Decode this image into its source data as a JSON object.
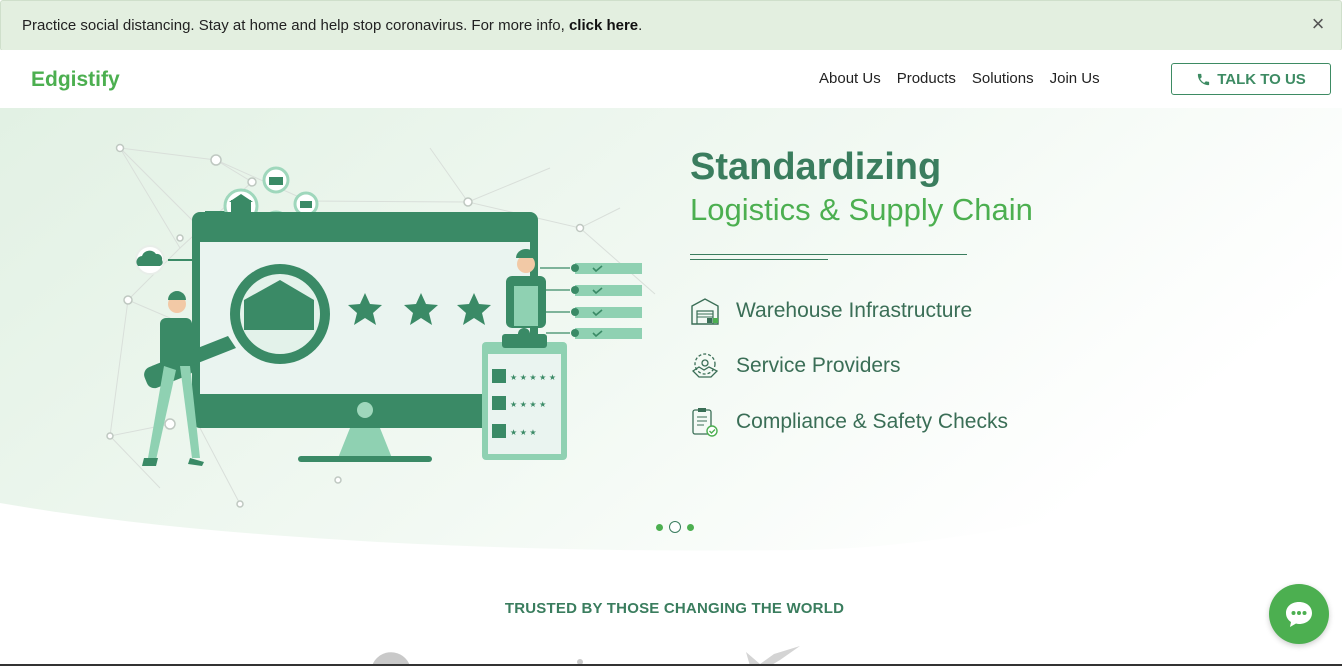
{
  "alert": {
    "text": "Practice social distancing. Stay at home and help stop coronavirus. For more info, ",
    "link": "click here",
    "suffix": ".",
    "close": "×"
  },
  "header": {
    "logo": "Edgistify",
    "nav": [
      "About Us",
      "Products",
      "Solutions",
      "Join Us"
    ],
    "cta": "TALK TO US"
  },
  "hero": {
    "title": "Standardizing",
    "subtitle": "Logistics & Supply Chain",
    "features": [
      {
        "label": "Warehouse Infrastructure",
        "icon": "warehouse-icon"
      },
      {
        "label": "Service Providers",
        "icon": "handshake-gear-icon"
      },
      {
        "label": "Compliance & Safety Checks",
        "icon": "clipboard-check-icon"
      }
    ],
    "slides": 3,
    "active_slide": 2
  },
  "trusted": {
    "heading": "TRUSTED BY THOSE CHANGING THE WORLD"
  },
  "colors": {
    "brand_green": "#4caf50",
    "dark_green": "#3a7d5e",
    "alert_bg": "#e3efe0",
    "hero_bg": "#e4f2e6"
  }
}
